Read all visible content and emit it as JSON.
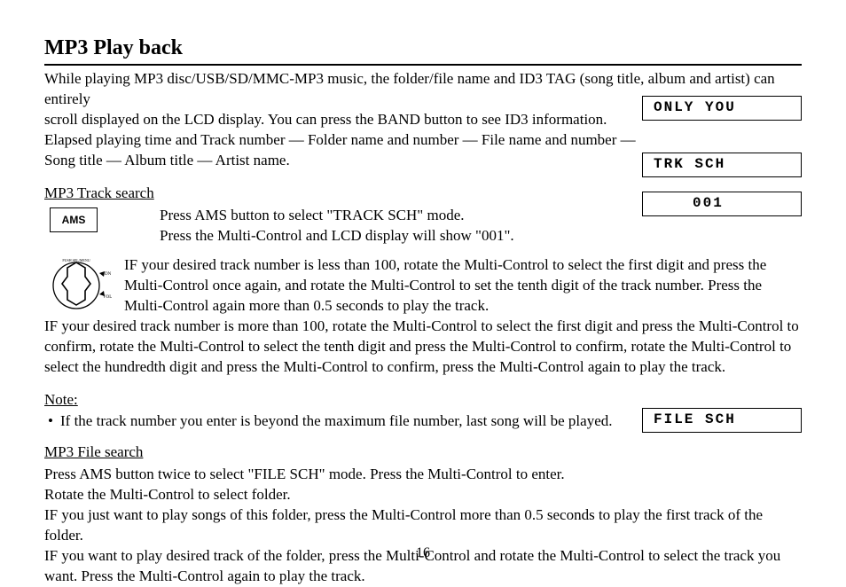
{
  "title": "MP3 Play back",
  "intro_line1": "While playing MP3 disc/USB/SD/MMC-MP3 music, the folder/file name and ID3 TAG (song title, album and artist) can entirely",
  "intro_line2": "scroll displayed on the LCD display. You can press the BAND button to see ID3 information.",
  "intro_line3": "Elapsed playing time and Track number — Folder name and number — File name and number —",
  "intro_line4": "Song title — Album title — Artist name.",
  "lcd1": "ONLY YOU",
  "lcd2": "TRK SCH",
  "lcd3": "001",
  "tracksearch_heading": "MP3 Track search",
  "ams_label": "AMS",
  "ams_line1": "Press AMS button to select \"TRACK SCH\" mode.",
  "ams_line2": "Press the Multi-Control and LCD display will show \"001\".",
  "knob_para": "IF your desired track number is less than 100, rotate the Multi-Control to select the first digit and press the Multi-Control once again, and rotate the Multi-Control to set the tenth digit of the track number. Press the Multi-Control again more than 0.5 seconds to play the track.",
  "over100_para": "IF your desired track number is more than 100, rotate the Multi-Control to select the first digit and press the Multi-Control to confirm, rotate the Multi-Control to select the tenth digit and press the Multi-Control to confirm, rotate the Multi-Control to select the hundredth digit and press the Multi-Control to confirm, press the Multi-Control again to play the track.",
  "note_heading": "Note:",
  "note_bullet": "If the track number you enter is beyond the maximum file number, last song will be played.",
  "filesearch_heading": "MP3 File search",
  "lcd4": "FILE SCH",
  "file_para1": "Press AMS button twice to select \"FILE SCH\" mode. Press the Multi-Control to enter.",
  "file_para2": "Rotate the Multi-Control to select folder.",
  "file_para3": "IF you just want to play songs of this folder, press the Multi-Control more than 0.5 seconds to play the first track of the folder.",
  "file_para4": "IF you want to play desired track of the folder, press the Multi-Control and rotate the Multi-Control to select the track you want. Press the Multi-Control again to play the track.",
  "page_number": "16"
}
